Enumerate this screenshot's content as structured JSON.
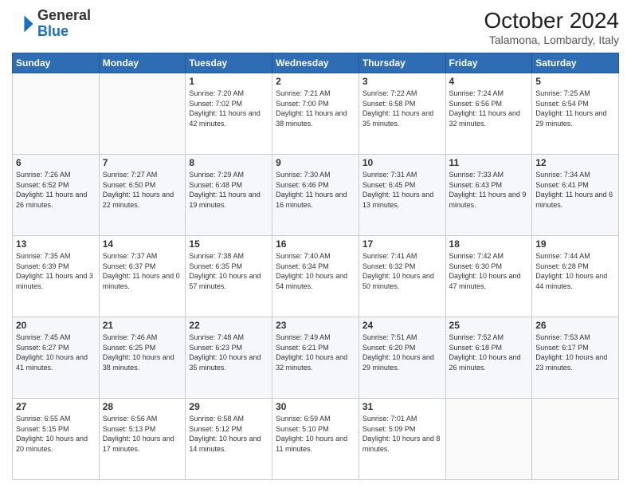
{
  "header": {
    "logo": {
      "general": "General",
      "blue": "Blue"
    },
    "title": "October 2024",
    "location": "Talamona, Lombardy, Italy"
  },
  "calendar": {
    "days_of_week": [
      "Sunday",
      "Monday",
      "Tuesday",
      "Wednesday",
      "Thursday",
      "Friday",
      "Saturday"
    ],
    "weeks": [
      [
        {
          "day": "",
          "info": ""
        },
        {
          "day": "",
          "info": ""
        },
        {
          "day": "1",
          "info": "Sunrise: 7:20 AM\nSunset: 7:02 PM\nDaylight: 11 hours and 42 minutes."
        },
        {
          "day": "2",
          "info": "Sunrise: 7:21 AM\nSunset: 7:00 PM\nDaylight: 11 hours and 38 minutes."
        },
        {
          "day": "3",
          "info": "Sunrise: 7:22 AM\nSunset: 6:58 PM\nDaylight: 11 hours and 35 minutes."
        },
        {
          "day": "4",
          "info": "Sunrise: 7:24 AM\nSunset: 6:56 PM\nDaylight: 11 hours and 32 minutes."
        },
        {
          "day": "5",
          "info": "Sunrise: 7:25 AM\nSunset: 6:54 PM\nDaylight: 11 hours and 29 minutes."
        }
      ],
      [
        {
          "day": "6",
          "info": "Sunrise: 7:26 AM\nSunset: 6:52 PM\nDaylight: 11 hours and 26 minutes."
        },
        {
          "day": "7",
          "info": "Sunrise: 7:27 AM\nSunset: 6:50 PM\nDaylight: 11 hours and 22 minutes."
        },
        {
          "day": "8",
          "info": "Sunrise: 7:29 AM\nSunset: 6:48 PM\nDaylight: 11 hours and 19 minutes."
        },
        {
          "day": "9",
          "info": "Sunrise: 7:30 AM\nSunset: 6:46 PM\nDaylight: 11 hours and 16 minutes."
        },
        {
          "day": "10",
          "info": "Sunrise: 7:31 AM\nSunset: 6:45 PM\nDaylight: 11 hours and 13 minutes."
        },
        {
          "day": "11",
          "info": "Sunrise: 7:33 AM\nSunset: 6:43 PM\nDaylight: 11 hours and 9 minutes."
        },
        {
          "day": "12",
          "info": "Sunrise: 7:34 AM\nSunset: 6:41 PM\nDaylight: 11 hours and 6 minutes."
        }
      ],
      [
        {
          "day": "13",
          "info": "Sunrise: 7:35 AM\nSunset: 6:39 PM\nDaylight: 11 hours and 3 minutes."
        },
        {
          "day": "14",
          "info": "Sunrise: 7:37 AM\nSunset: 6:37 PM\nDaylight: 11 hours and 0 minutes."
        },
        {
          "day": "15",
          "info": "Sunrise: 7:38 AM\nSunset: 6:35 PM\nDaylight: 10 hours and 57 minutes."
        },
        {
          "day": "16",
          "info": "Sunrise: 7:40 AM\nSunset: 6:34 PM\nDaylight: 10 hours and 54 minutes."
        },
        {
          "day": "17",
          "info": "Sunrise: 7:41 AM\nSunset: 6:32 PM\nDaylight: 10 hours and 50 minutes."
        },
        {
          "day": "18",
          "info": "Sunrise: 7:42 AM\nSunset: 6:30 PM\nDaylight: 10 hours and 47 minutes."
        },
        {
          "day": "19",
          "info": "Sunrise: 7:44 AM\nSunset: 6:28 PM\nDaylight: 10 hours and 44 minutes."
        }
      ],
      [
        {
          "day": "20",
          "info": "Sunrise: 7:45 AM\nSunset: 6:27 PM\nDaylight: 10 hours and 41 minutes."
        },
        {
          "day": "21",
          "info": "Sunrise: 7:46 AM\nSunset: 6:25 PM\nDaylight: 10 hours and 38 minutes."
        },
        {
          "day": "22",
          "info": "Sunrise: 7:48 AM\nSunset: 6:23 PM\nDaylight: 10 hours and 35 minutes."
        },
        {
          "day": "23",
          "info": "Sunrise: 7:49 AM\nSunset: 6:21 PM\nDaylight: 10 hours and 32 minutes."
        },
        {
          "day": "24",
          "info": "Sunrise: 7:51 AM\nSunset: 6:20 PM\nDaylight: 10 hours and 29 minutes."
        },
        {
          "day": "25",
          "info": "Sunrise: 7:52 AM\nSunset: 6:18 PM\nDaylight: 10 hours and 26 minutes."
        },
        {
          "day": "26",
          "info": "Sunrise: 7:53 AM\nSunset: 6:17 PM\nDaylight: 10 hours and 23 minutes."
        }
      ],
      [
        {
          "day": "27",
          "info": "Sunrise: 6:55 AM\nSunset: 5:15 PM\nDaylight: 10 hours and 20 minutes."
        },
        {
          "day": "28",
          "info": "Sunrise: 6:56 AM\nSunset: 5:13 PM\nDaylight: 10 hours and 17 minutes."
        },
        {
          "day": "29",
          "info": "Sunrise: 6:58 AM\nSunset: 5:12 PM\nDaylight: 10 hours and 14 minutes."
        },
        {
          "day": "30",
          "info": "Sunrise: 6:59 AM\nSunset: 5:10 PM\nDaylight: 10 hours and 11 minutes."
        },
        {
          "day": "31",
          "info": "Sunrise: 7:01 AM\nSunset: 5:09 PM\nDaylight: 10 hours and 8 minutes."
        },
        {
          "day": "",
          "info": ""
        },
        {
          "day": "",
          "info": ""
        }
      ]
    ]
  }
}
